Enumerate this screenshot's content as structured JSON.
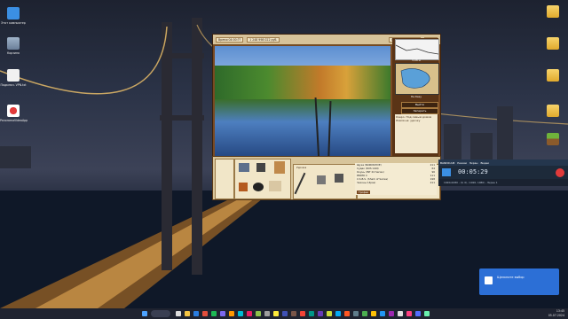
{
  "desktop": {
    "left_icons": [
      {
        "label": "Этот компьютер",
        "icon": "monitor-icon"
      },
      {
        "label": "Корзина",
        "icon": "recycle-bin-icon"
      },
      {
        "label": "Подключ. VPN.txt",
        "icon": "text-file-icon"
      },
      {
        "label": "PanoramaVideoApp",
        "icon": "app-icon"
      }
    ],
    "right_icons": [
      {
        "label": "",
        "icon": "folder-icon"
      },
      {
        "label": "",
        "icon": "folder-icon"
      },
      {
        "label": "",
        "icon": "folder-icon"
      },
      {
        "label": "",
        "icon": "folder-icon"
      },
      {
        "label": "",
        "icon": "minecraft-icon"
      }
    ]
  },
  "game": {
    "top_bar": {
      "time": "Время 04:00:??",
      "money": "1 248 998 022 руб.",
      "buttons": [
        "Создать профиль",
        "Меню"
      ]
    },
    "right_panel": {
      "depth_label": "3,08 м",
      "lake_name": "На базу",
      "btn_go": "Выйти",
      "btn_extra": "Запереть",
      "info_title": "Озеро. Под самым домом",
      "info_line": "Ловля на: удочку"
    },
    "catch_list": [
      {
        "name": "Щука (NORMATIVE)",
        "weight": "211"
      },
      {
        "name": "Судак (RUS CAN)",
        "weight": "64"
      },
      {
        "name": "Окунь (INT 24 Series)",
        "weight": "96"
      },
      {
        "name": "PRIMO C",
        "weight": "111"
      },
      {
        "name": "X.S.B.S. (Shark of Series)",
        "weight": "198"
      },
      {
        "name": "Чехонь (Ulpas)",
        "weight": "211"
      }
    ],
    "tackle_tab": "Удочка",
    "bag_tab": "Сумка",
    "button_confirm": "Трофеи"
  },
  "recorder": {
    "title": "BANDICAM",
    "tabs": [
      "Режим",
      "Экран",
      "Видео"
    ],
    "time": "00:05:29",
    "sub": "1920x1080 - (0, 0), (1920, 1080) - Экран 1"
  },
  "toast": {
    "text": "Щелкните выбор"
  },
  "taskbar": {
    "time": "13:45",
    "date": "05.07.2024"
  },
  "colors": {
    "game_frame": "#7a4a22",
    "recorder_bg": "#1d2a3a",
    "toast_bg": "#2c6fd6",
    "taskbar_bg": "#1f2330"
  }
}
